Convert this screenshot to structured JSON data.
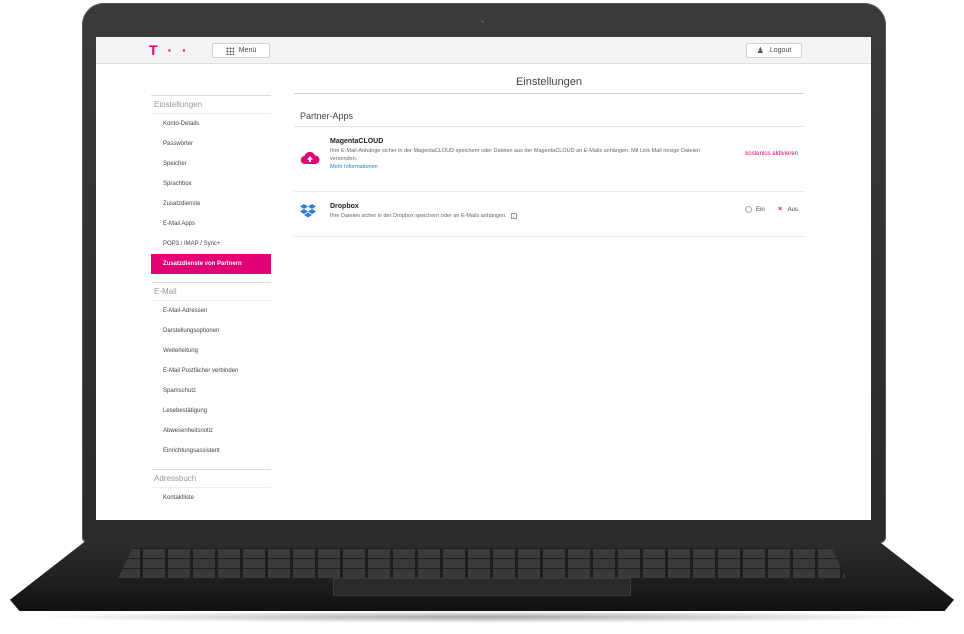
{
  "header": {
    "logo_text": "T · ·",
    "menu_label": "Menü",
    "logout_label": "Logout"
  },
  "page": {
    "title": "Einstellungen"
  },
  "sidebar": {
    "sections": [
      {
        "heading": "Einstellungen",
        "items": [
          "Konto-Details",
          "Passwörter",
          "Speicher",
          "Sprachbox",
          "Zusatzdienste",
          "E-Mail Apps",
          "POP3 / IMAP / Sync+",
          "Zusatzdienste von Partnern"
        ]
      },
      {
        "heading": "E-Mail",
        "items": [
          "E-Mail-Adressen",
          "Darstellungsoptionen",
          "Weiterleitung",
          "E-Mail Postfächer verbinden",
          "Spamschutz",
          "Lesebestätigung",
          "Abwesenheitsnotiz",
          "Einrichtungsassistent"
        ]
      },
      {
        "heading": "Adressbuch",
        "items": [
          "Kontaktliste"
        ]
      }
    ],
    "active_item": "Zusatzdienste von Partnern"
  },
  "partner_apps": {
    "section_title": "Partner-Apps",
    "apps": [
      {
        "name": "MagentaCLOUD",
        "description": "Ihre E-Mail-Anhänge sicher in der MagentaCLOUD speichern oder Dateien aus der MagentaCLOUD an E-Mails anhängen. Mit Link Mail riesige Dateien versenden.",
        "link": "Mehr Informationen",
        "action": "kostenlos aktivieren"
      },
      {
        "name": "Dropbox",
        "description": "Ihre Dateien sicher in der Dropbox speichern oder an E-Mails anhängen.",
        "options": [
          "Ein",
          "Aus"
        ],
        "selected": "Aus"
      }
    ]
  },
  "colors": {
    "brand": "#e20074",
    "link": "#1a7fc9",
    "dropbox": "#2a7de1"
  }
}
